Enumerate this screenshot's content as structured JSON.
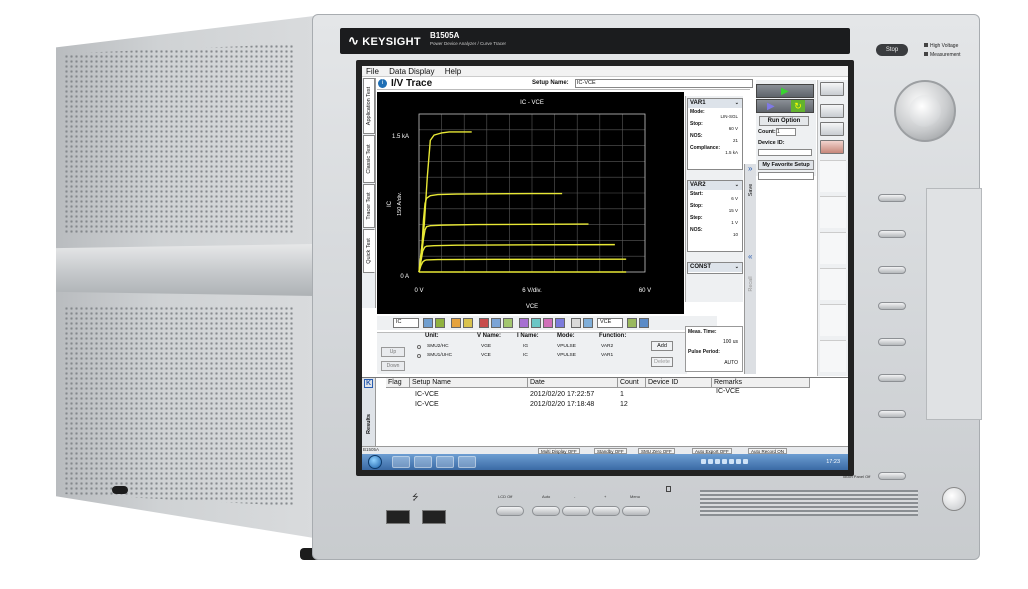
{
  "instrument": {
    "brand": "KEYSIGHT",
    "model": "B1505A",
    "subtitle": "Power Device Analyzer / Curve Tracer",
    "stop_label": "Stop",
    "hv_label": "High Voltage",
    "measure_label": "Measurement",
    "front_buttons": [
      "LCD Off",
      "Auto",
      "-",
      "+",
      "Menu"
    ],
    "touch_panel_label": "Touch Panel Off"
  },
  "app": {
    "menu": [
      "File",
      "Data Display",
      "Help"
    ],
    "side_tabs": [
      "Application Test",
      "Classic Test",
      "Tracer Test",
      "Quick Test"
    ],
    "page_title": "I/V Trace",
    "setup_name_label": "Setup Name:",
    "setup_name_value": "IC-VCE",
    "run_option_label": "Run Option",
    "count_label": "Count:",
    "count_value": "1",
    "device_id_label": "Device ID:",
    "favorite_label": "My Favorite Setup",
    "save_label": "Save",
    "recall_label": "Recall"
  },
  "graph": {
    "title": "IC - VCE",
    "y_top": "1.5 kA",
    "y_zero": "0 A",
    "y_axis_name": "IC",
    "y_div": "150 A/div.",
    "x_left": "0 V",
    "x_div": "6 V/div.",
    "x_right": "60 V",
    "x_axis_name": "VCE",
    "trace_color": "#e8e835",
    "grid_color": "#5a5a5a"
  },
  "chart_data": {
    "type": "line",
    "title": "IC - VCE",
    "xlabel": "VCE",
    "ylabel": "IC",
    "xlim": [
      0,
      60
    ],
    "ylim": [
      0,
      1500
    ],
    "grid": true,
    "series": [
      {
        "x": [
          0,
          1.4,
          2.2,
          3,
          4,
          5,
          6,
          8,
          14
        ],
        "y": [
          0,
          450,
          900,
          1250,
          1300,
          1310,
          1320,
          1330,
          1330
        ]
      },
      {
        "x": [
          0,
          0.8,
          1.2,
          1.6,
          2,
          3,
          5,
          10,
          30,
          38
        ],
        "y": [
          0,
          250,
          500,
          650,
          700,
          725,
          735,
          740,
          745,
          745
        ]
      },
      {
        "x": [
          0,
          0.8,
          1.2,
          1.6,
          2,
          3,
          6,
          15,
          45
        ],
        "y": [
          0,
          200,
          320,
          400,
          430,
          440,
          445,
          450,
          455
        ]
      },
      {
        "x": [
          0,
          0.6,
          1,
          1.5,
          2,
          4,
          10,
          30,
          52
        ],
        "y": [
          0,
          120,
          200,
          235,
          245,
          250,
          255,
          258,
          260
        ]
      },
      {
        "x": [
          0,
          0.5,
          1,
          1.5,
          2,
          5,
          20,
          55
        ],
        "y": [
          0,
          60,
          95,
          110,
          115,
          118,
          120,
          122
        ]
      },
      {
        "x": [
          0,
          55
        ],
        "y": [
          0,
          0
        ]
      }
    ]
  },
  "var1": {
    "title": "VAR1",
    "rows": [
      {
        "label": "Mode:",
        "value": "LIN-SGL"
      },
      {
        "label": "Stop:",
        "value": "60 V"
      },
      {
        "label": "NOS:",
        "value": "21"
      },
      {
        "label": "Compliance:",
        "value": "1.5 kA"
      }
    ]
  },
  "var2": {
    "title": "VAR2",
    "rows": [
      {
        "label": "Start:",
        "value": "6 V"
      },
      {
        "label": "Stop:",
        "value": "15 V"
      },
      {
        "label": "Step:",
        "value": "1 V"
      },
      {
        "label": "NOS:",
        "value": "10"
      }
    ]
  },
  "const_title": "CONST",
  "toolbar": {
    "sel1": "IC",
    "sel2": "VCE"
  },
  "units": {
    "headers": {
      "unit": "Unit:",
      "vname": "V Name:",
      "iname": "I Name:",
      "mode": "Mode:",
      "function": "Function:"
    },
    "rows": [
      {
        "unit": "SMU2/HC",
        "vname": "VGE",
        "iname": "IG",
        "mode": "VPULSE",
        "function": "VAR2"
      },
      {
        "unit": "SMU1/UHC",
        "vname": "VCE",
        "iname": "IC",
        "mode": "VPULSE",
        "function": "VAR1"
      }
    ],
    "up_label": "Up",
    "down_label": "Down",
    "add_label": "Add",
    "delete_label": "Delete"
  },
  "meas": {
    "time_label": "Meas. Time:",
    "time_value": "100 us",
    "period_label": "Pulse Period:",
    "period_value": "AUTO"
  },
  "results": {
    "tab_label": "Results",
    "columns": [
      "Flag",
      "Setup Name",
      "Date",
      "Count",
      "Device ID",
      "Remarks"
    ],
    "rows": [
      {
        "flag": "",
        "setup": "IC-VCE",
        "date": "2012/02/20 17:22:57",
        "count": "1",
        "device": "",
        "remarks": "IC-VCE"
      },
      {
        "flag": "",
        "setup": "IC-VCE",
        "date": "2012/02/20 17:18:48",
        "count": "12",
        "device": "",
        "remarks": ""
      }
    ]
  },
  "statusbar": {
    "name": "B1505A",
    "items": [
      "Multi Display OFF",
      "Standby OFF",
      "SMU Zero OFF",
      "Auto Export OFF",
      "Auto Record ON"
    ]
  },
  "taskbar": {
    "clock": "17:23"
  }
}
